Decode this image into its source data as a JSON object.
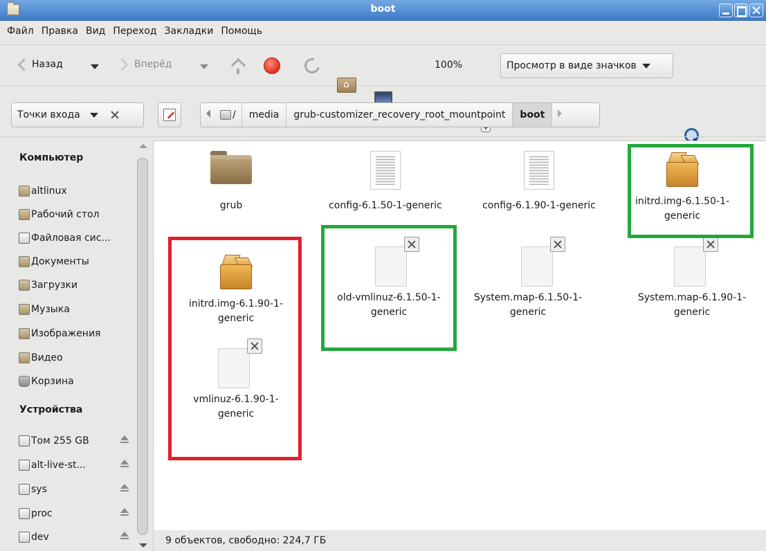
{
  "window": {
    "title": "boot"
  },
  "menu": [
    "Файл",
    "Правка",
    "Вид",
    "Переход",
    "Закладки",
    "Помощь"
  ],
  "toolbar": {
    "back_label": "Назад",
    "forward_label": "Вперёд",
    "zoom_level": "100%",
    "view_mode": "Просмотр в виде значков"
  },
  "location": {
    "places_label": "Точки входа",
    "path": [
      "/",
      "media",
      "grub-customizer_recovery_root_mountpoint",
      "boot"
    ]
  },
  "sidebar": {
    "computer_heading": "Компьютер",
    "computer_items": [
      "altlinux",
      "Рабочий стол",
      "Файловая сис...",
      "Документы",
      "Загрузки",
      "Музыка",
      "Изображения",
      "Видео",
      "Корзина"
    ],
    "devices_heading": "Устройства",
    "device_items": [
      "Том 255 GB",
      "alt-live-st...",
      "sys",
      "proc",
      "dev"
    ]
  },
  "files": [
    {
      "name": "grub",
      "icon": "folder-icon"
    },
    {
      "name": "config-6.1.50-1-generic",
      "icon": "text-file-icon"
    },
    {
      "name": "config-6.1.90-1-generic",
      "icon": "text-file-icon"
    },
    {
      "name": "initrd.img-6.1.50-1-generic",
      "icon": "package-icon"
    },
    {
      "name": "initrd.img-6.1.90-1-generic",
      "icon": "package-icon"
    },
    {
      "name": "old-vmlinuz-6.1.50-1-generic",
      "icon": "broken-file-icon"
    },
    {
      "name": "System.map-6.1.50-1-generic",
      "icon": "broken-file-icon"
    },
    {
      "name": "System.map-6.1.90-1-generic",
      "icon": "broken-file-icon"
    },
    {
      "name": "vmlinuz-6.1.90-1-generic",
      "icon": "broken-file-icon"
    }
  ],
  "highlight_colors": {
    "green": "#22a83a",
    "red": "#e0202c"
  },
  "status": "9 объектов, свободно: 224,7 ГБ"
}
